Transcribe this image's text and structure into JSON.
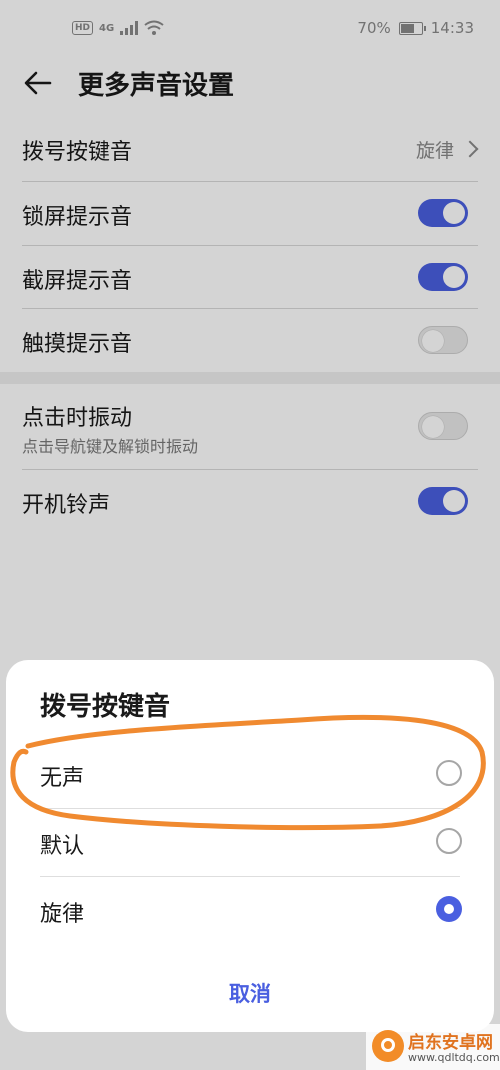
{
  "status_bar": {
    "hd_label": "HD",
    "network_label": "4G",
    "battery_text": "70%",
    "battery_level": 0.7,
    "time": "14:33"
  },
  "header": {
    "title": "更多声音设置"
  },
  "settings": [
    {
      "label": "拨号按键音",
      "value": "旋律",
      "type": "value"
    },
    {
      "label": "锁屏提示音",
      "toggle": true,
      "type": "toggle"
    },
    {
      "label": "截屏提示音",
      "toggle": true,
      "type": "toggle"
    },
    {
      "label": "触摸提示音",
      "toggle": false,
      "type": "toggle"
    },
    {
      "label": "点击时振动",
      "sublabel": "点击导航键及解锁时振动",
      "toggle": false,
      "type": "toggle"
    },
    {
      "label": "开机铃声",
      "toggle": true,
      "type": "toggle"
    }
  ],
  "dialog": {
    "title": "拨号按键音",
    "options": [
      {
        "label": "无声",
        "selected": false
      },
      {
        "label": "默认",
        "selected": false
      },
      {
        "label": "旋律",
        "selected": true
      }
    ],
    "cancel_label": "取消"
  },
  "watermark": {
    "name": "启东安卓网",
    "url": "www.qdltdq.com"
  },
  "colors": {
    "accent": "#4a5fe0",
    "annotation": "#f08a30",
    "watermark": "#e0731f"
  }
}
